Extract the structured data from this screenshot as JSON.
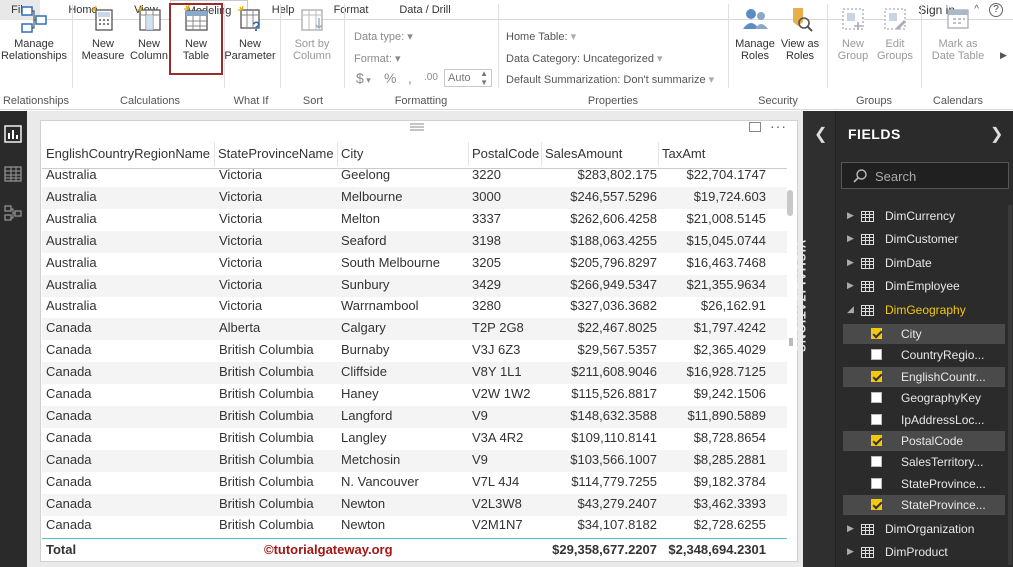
{
  "menubar": {
    "file": "File",
    "tabs": [
      "Home",
      "View",
      "Modeling",
      "Help",
      "Format",
      "Data / Drill"
    ],
    "active_tab": "Modeling",
    "signin": "Sign in",
    "help": "?"
  },
  "ribbon": {
    "buttons": {
      "manage_relationships": "Manage Relationships",
      "new_measure": "New Measure",
      "new_column": "New Column",
      "new_table": "New Table",
      "new_parameter": "New Parameter",
      "sort_by_column": "Sort by Column",
      "manage_roles": "Manage Roles",
      "view_as_roles": "View as Roles",
      "new_group": "New Group",
      "edit_groups": "Edit Groups",
      "mark_as_date_table": "Mark as Date Table"
    },
    "groups": {
      "relationships": "Relationships",
      "calculations": "Calculations",
      "what_if": "What If",
      "sort": "Sort",
      "formatting": "Formatting",
      "properties": "Properties",
      "security": "Security",
      "groups": "Groups",
      "calendars": "Calendars"
    },
    "formatting": {
      "data_type": "Data type:",
      "format": "Format:",
      "currency": "$",
      "percent": "%",
      "comma": ",",
      "decimals": ".00",
      "auto": "Auto"
    },
    "properties": {
      "home_table": "Home Table:",
      "data_category": "Data Category: Uncategorized",
      "default_summarization": "Default Summarization: Don't summarize"
    }
  },
  "table": {
    "headers": [
      "EnglishCountryRegionName",
      "StateProvinceName",
      "City",
      "PostalCode",
      "SalesAmount",
      "TaxAmt"
    ],
    "rows": [
      [
        "Australia",
        "Victoria",
        "Geelong",
        "3220",
        "$283,802.175",
        "$22,704.1747"
      ],
      [
        "Australia",
        "Victoria",
        "Melbourne",
        "3000",
        "$246,557.5296",
        "$19,724.603"
      ],
      [
        "Australia",
        "Victoria",
        "Melton",
        "3337",
        "$262,606.4258",
        "$21,008.5145"
      ],
      [
        "Australia",
        "Victoria",
        "Seaford",
        "3198",
        "$188,063.4255",
        "$15,045.0744"
      ],
      [
        "Australia",
        "Victoria",
        "South Melbourne",
        "3205",
        "$205,796.8297",
        "$16,463.7468"
      ],
      [
        "Australia",
        "Victoria",
        "Sunbury",
        "3429",
        "$266,949.5347",
        "$21,355.9634"
      ],
      [
        "Australia",
        "Victoria",
        "Warrnambool",
        "3280",
        "$327,036.3682",
        "$26,162.91"
      ],
      [
        "Canada",
        "Alberta",
        "Calgary",
        "T2P 2G8",
        "$22,467.8025",
        "$1,797.4242"
      ],
      [
        "Canada",
        "British Columbia",
        "Burnaby",
        "V3J 6Z3",
        "$29,567.5357",
        "$2,365.4029"
      ],
      [
        "Canada",
        "British Columbia",
        "Cliffside",
        "V8Y 1L1",
        "$211,608.9046",
        "$16,928.7125"
      ],
      [
        "Canada",
        "British Columbia",
        "Haney",
        "V2W 1W2",
        "$115,526.8817",
        "$9,242.1506"
      ],
      [
        "Canada",
        "British Columbia",
        "Langford",
        "V9",
        "$148,632.3588",
        "$11,890.5889"
      ],
      [
        "Canada",
        "British Columbia",
        "Langley",
        "V3A 4R2",
        "$109,110.8141",
        "$8,728.8654"
      ],
      [
        "Canada",
        "British Columbia",
        "Metchosin",
        "V9",
        "$103,566.1007",
        "$8,285.2881"
      ],
      [
        "Canada",
        "British Columbia",
        "N. Vancouver",
        "V7L 4J4",
        "$114,779.7255",
        "$9,182.3784"
      ],
      [
        "Canada",
        "British Columbia",
        "Newton",
        "V2L3W8",
        "$43,279.2407",
        "$3,462.3393"
      ],
      [
        "Canada",
        "British Columbia",
        "Newton",
        "V2M1N7",
        "$34,107.8182",
        "$2,728.6255"
      ]
    ],
    "total_label": "Total",
    "watermark": "©tutorialgateway.org",
    "total_sales": "$29,358,677.2207",
    "total_tax": "$2,348,694.2301"
  },
  "visualizations": {
    "label": "VISUALIZATIONS"
  },
  "fields": {
    "title": "FIELDS",
    "search_placeholder": "Search",
    "tables_before": [
      "DimCurrency",
      "DimCustomer",
      "DimDate",
      "DimEmployee"
    ],
    "open_table": "DimGeography",
    "geo_fields": [
      {
        "name": "City",
        "checked": true
      },
      {
        "name": "CountryRegio...",
        "checked": false
      },
      {
        "name": "EnglishCountr...",
        "checked": true
      },
      {
        "name": "GeographyKey",
        "checked": false
      },
      {
        "name": "IpAddressLoc...",
        "checked": false
      },
      {
        "name": "PostalCode",
        "checked": true
      },
      {
        "name": "SalesTerritory...",
        "checked": false
      },
      {
        "name": "StateProvince...",
        "checked": false
      },
      {
        "name": "StateProvince...",
        "checked": true
      }
    ],
    "tables_after": [
      "DimOrganization",
      "DimProduct"
    ]
  },
  "colors": {
    "accent": "#f2c811",
    "selection": "#9b2c2c",
    "total_line": "#4fc3c3"
  }
}
